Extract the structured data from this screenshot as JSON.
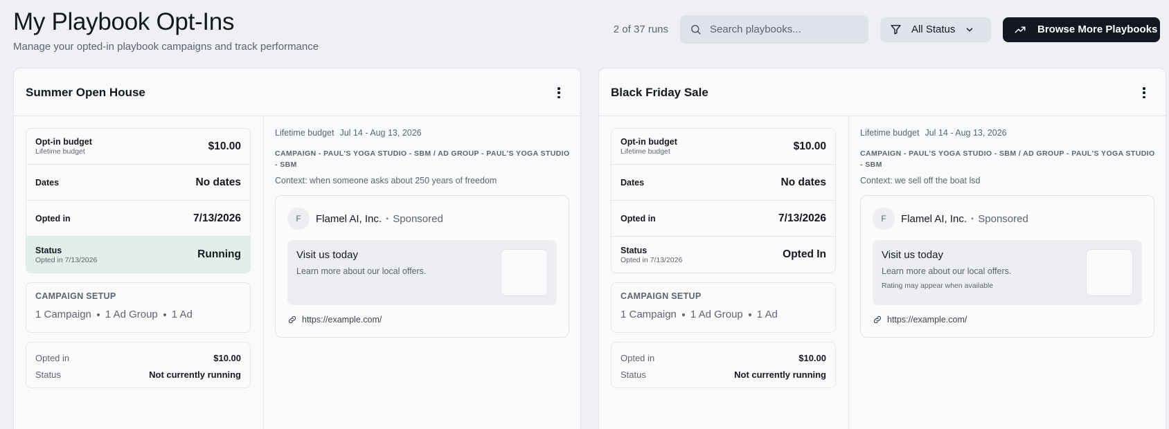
{
  "header": {
    "title": "My Playbook Opt-Ins",
    "subtitle": "Manage your opted-in playbook campaigns and track performance"
  },
  "toolbar": {
    "runs_count": "2 of 37 runs",
    "search_placeholder": "Search playbooks...",
    "status_filter_label": "All Status",
    "browse_label": "Browse More Playbooks"
  },
  "cards": [
    {
      "title": "Summer Open House",
      "info": {
        "budget_label": "Opt-in budget",
        "budget_sub": "Lifetime budget",
        "budget_value": "$10.00",
        "dates_label": "Dates",
        "dates_value": "No dates",
        "opted_label": "Opted in",
        "opted_value": "7/13/2026",
        "status_label": "Status",
        "status_sub": "Opted in 7/13/2026",
        "status_value": "Running"
      },
      "setup": {
        "title": "CAMPAIGN SETUP",
        "campaigns": "1 Campaign",
        "ad_groups": "1 Ad Group",
        "ads": "1 Ad"
      },
      "summary": {
        "opted_label": "Opted in",
        "opted_value": "$10.00",
        "status_label": "Status",
        "status_value": "Not currently running"
      },
      "detail": {
        "budget_label": "Lifetime budget",
        "date_range": "Jul 14 - Aug 13, 2026",
        "campaign_path": "CAMPAIGN - PAUL'S YOGA STUDIO - SBM / AD GROUP - PAUL'S YOGA STUDIO - SBM",
        "context": "Context: when someone asks about 250 years of freedom"
      },
      "ad": {
        "avatar_letter": "F",
        "company": "Flamel AI, Inc.",
        "dot": "•",
        "sponsored": "Sponsored",
        "headline": "Visit us today",
        "description": "Learn more about our local offers.",
        "note": "",
        "url": "https://example.com/"
      }
    },
    {
      "title": "Black Friday Sale",
      "info": {
        "budget_label": "Opt-in budget",
        "budget_sub": "Lifetime budget",
        "budget_value": "$10.00",
        "dates_label": "Dates",
        "dates_value": "No dates",
        "opted_label": "Opted in",
        "opted_value": "7/13/2026",
        "status_label": "Status",
        "status_sub": "Opted in 7/13/2026",
        "status_value": "Opted In"
      },
      "setup": {
        "title": "CAMPAIGN SETUP",
        "campaigns": "1 Campaign",
        "ad_groups": "1 Ad Group",
        "ads": "1 Ad"
      },
      "summary": {
        "opted_label": "Opted in",
        "opted_value": "$10.00",
        "status_label": "Status",
        "status_value": "Not currently running"
      },
      "detail": {
        "budget_label": "Lifetime budget",
        "date_range": "Jul 14 - Aug 13, 2026",
        "campaign_path": "CAMPAIGN - PAUL'S YOGA STUDIO - SBM / AD GROUP - PAUL'S YOGA STUDIO - SBM",
        "context": "Context: we sell off the boat lsd"
      },
      "ad": {
        "avatar_letter": "F",
        "company": "Flamel AI, Inc.",
        "dot": "•",
        "sponsored": "Sponsored",
        "headline": "Visit us today",
        "description": "Learn more about our local offers.",
        "note": "Rating may appear when available",
        "url": "https://example.com/"
      }
    }
  ],
  "colors": {
    "background": "#eef0f4",
    "running_highlight": "#e2efe9",
    "primary_button": "#121722"
  }
}
